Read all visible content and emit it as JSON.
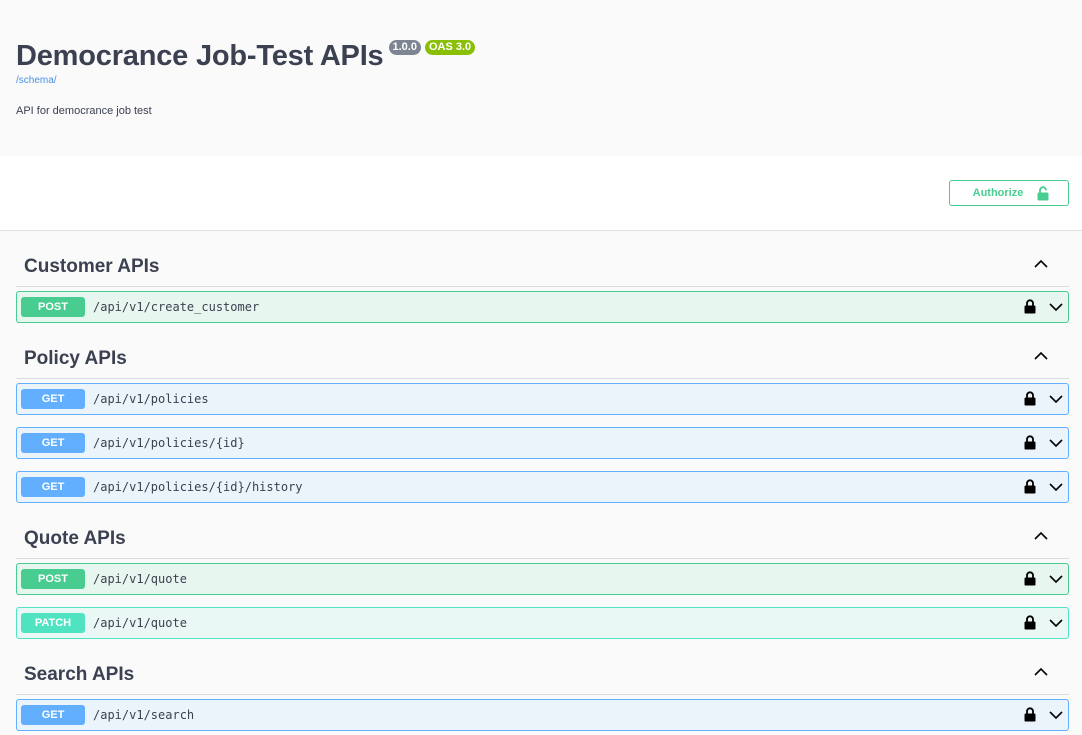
{
  "info": {
    "title": "Democrance Job-Test APIs",
    "version": "1.0.0",
    "oas": "OAS 3.0",
    "schema_link": "/schema/",
    "description": "API for democrance job test"
  },
  "authorize": {
    "label": "Authorize"
  },
  "sections": [
    {
      "title": "Customer APIs",
      "operations": [
        {
          "method": "POST",
          "path": "/api/v1/create_customer"
        }
      ]
    },
    {
      "title": "Policy APIs",
      "operations": [
        {
          "method": "GET",
          "path": "/api/v1/policies"
        },
        {
          "method": "GET",
          "path": "/api/v1/policies/{id}"
        },
        {
          "method": "GET",
          "path": "/api/v1/policies/{id}/history"
        }
      ]
    },
    {
      "title": "Quote APIs",
      "operations": [
        {
          "method": "POST",
          "path": "/api/v1/quote"
        },
        {
          "method": "PATCH",
          "path": "/api/v1/quote"
        }
      ]
    },
    {
      "title": "Search APIs",
      "operations": [
        {
          "method": "GET",
          "path": "/api/v1/search"
        }
      ]
    }
  ],
  "colors": {
    "post": "#49cc90",
    "get": "#61affe",
    "patch": "#50e3c2",
    "version_badge": "#7d8492",
    "oas_badge": "#89bf04"
  },
  "icons": {
    "section_toggle": "chevron-up-icon",
    "operation_lock": "lock-icon",
    "operation_expand": "chevron-down-icon",
    "authorize_lock": "unlocked-icon"
  }
}
